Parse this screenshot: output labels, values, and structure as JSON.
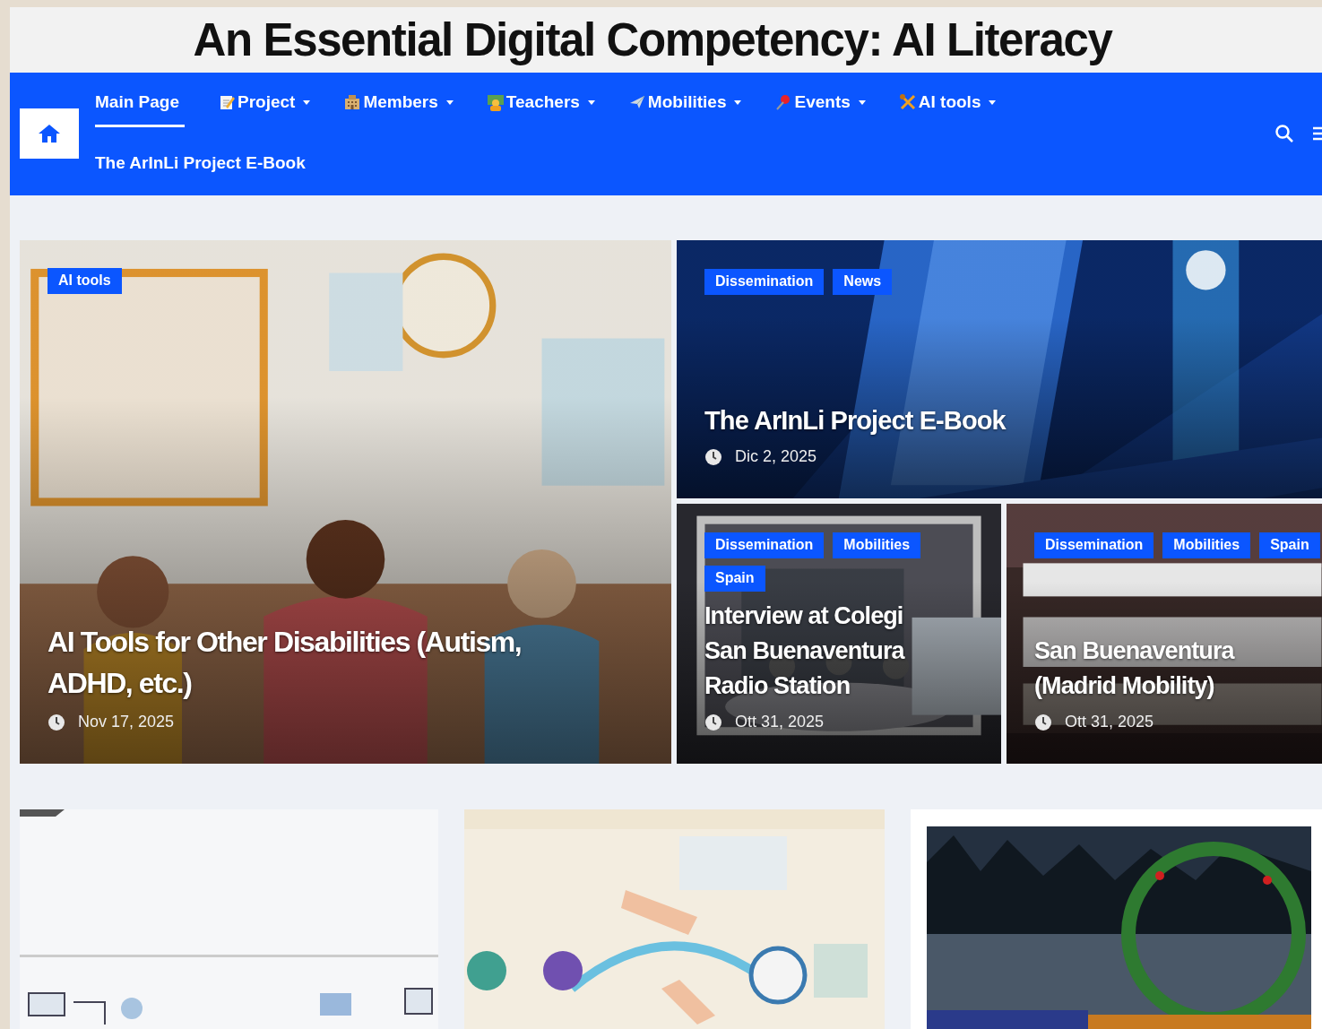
{
  "header": {
    "title": "An Essential Digital Competency: AI Literacy"
  },
  "nav": {
    "items": [
      {
        "label": "Main Page",
        "selected": true,
        "dropdown": false,
        "kind": "plain"
      },
      {
        "label": "Project",
        "selected": false,
        "dropdown": true,
        "kind": "memo"
      },
      {
        "label": "Members",
        "selected": false,
        "dropdown": true,
        "kind": "building"
      },
      {
        "label": "Teachers",
        "selected": false,
        "dropdown": true,
        "kind": "teacher"
      },
      {
        "label": "Mobilities",
        "selected": false,
        "dropdown": true,
        "kind": "plane"
      },
      {
        "label": "Events",
        "selected": false,
        "dropdown": true,
        "kind": "pin"
      },
      {
        "label": "AI tools",
        "selected": false,
        "dropdown": true,
        "kind": "tools"
      },
      {
        "label": "The ArInLi Project E-Book",
        "selected": false,
        "dropdown": false,
        "kind": "plain"
      }
    ]
  },
  "posts": [
    {
      "categories": [
        "AI tools"
      ],
      "title_lines": [
        "AI Tools for Other Disabilities (Autism,",
        "ADHD, etc.)"
      ],
      "date": "Nov 17, 2025"
    },
    {
      "categories": [
        "Dissemination",
        "News"
      ],
      "title_lines": [
        "The ArInLi Project E-Book"
      ],
      "date": "Dic 2, 2025"
    },
    {
      "categories": [
        "Dissemination",
        "Mobilities",
        "Spain"
      ],
      "title_lines": [
        "Interview at Colegi",
        "San Buenaventura",
        "Radio Station"
      ],
      "date": "Ott 31, 2025"
    },
    {
      "categories": [
        "Dissemination",
        "Mobilities",
        "Spain"
      ],
      "title_lines": [
        "San Buenaventura",
        "(Madrid Mobility)"
      ],
      "date": "Ott 31, 2025"
    }
  ]
}
